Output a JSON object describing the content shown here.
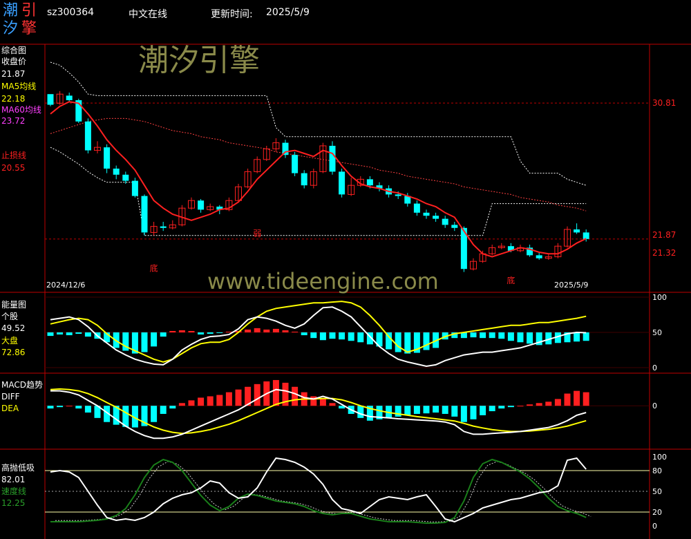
{
  "header": {
    "logo_chars": [
      "潮",
      "引",
      "汐",
      "擎"
    ],
    "code": "sz300364",
    "online": "中文在线",
    "update_label": "更新时间:",
    "update_date": "2025/5/9"
  },
  "watermarks": {
    "brand": "潮汐引擎",
    "url": "www.tideengine.com"
  },
  "colors": {
    "red": "#ff2020",
    "cyan": "#00ffff",
    "yellow": "#ffff00",
    "green": "#1a7f1a",
    "magenta": "#ff40ff",
    "divider": "#c00000"
  },
  "chart_data": [
    {
      "panel": "综合图",
      "type": "candlestick",
      "labels": {
        "close_label": "收盘价",
        "close_value": "21.87",
        "ma5_label": "MA5均线",
        "ma5_value": "22.18",
        "ma60_label": "MA60均线",
        "ma60_value": "23.72",
        "stop_label": "止损线",
        "stop_value": "20.55"
      },
      "ylim": [
        18.5,
        34.5
      ],
      "right_ticks": [
        30.81,
        21.87,
        21.32
      ],
      "annotations": [
        {
          "text": "底",
          "index": 11,
          "y": 20.2
        },
        {
          "text": "弱",
          "index": 22,
          "y": 22.5
        },
        {
          "text": "底",
          "index": 49,
          "y": 19.4
        }
      ],
      "date_start": "2024/12/6",
      "date_end": "2025/5/9",
      "candles": [
        [
          31.4,
          30.7,
          31.3,
          30.6
        ],
        [
          30.8,
          31.4,
          31.6,
          30.7
        ],
        [
          31.3,
          31.0,
          31.5,
          30.9
        ],
        [
          31.0,
          29.6,
          31.1,
          29.5
        ],
        [
          29.6,
          27.7,
          29.8,
          27.5
        ],
        [
          27.7,
          27.9,
          28.3,
          27.5
        ],
        [
          27.9,
          26.5,
          28.1,
          26.2
        ],
        [
          26.5,
          26.1,
          26.7,
          25.8
        ],
        [
          26.1,
          25.7,
          26.3,
          25.5
        ],
        [
          25.7,
          24.7,
          25.9,
          24.6
        ],
        [
          24.7,
          22.3,
          24.8,
          22.1
        ],
        [
          22.3,
          22.7,
          23.0,
          22.1
        ],
        [
          22.7,
          22.6,
          23.0,
          22.4
        ],
        [
          22.6,
          22.8,
          23.1,
          22.5
        ],
        [
          22.8,
          23.9,
          24.1,
          22.7
        ],
        [
          23.9,
          24.4,
          24.6,
          23.8
        ],
        [
          24.4,
          23.8,
          24.5,
          23.6
        ],
        [
          23.8,
          24.0,
          24.2,
          23.7
        ],
        [
          24.0,
          23.8,
          24.1,
          23.5
        ],
        [
          23.8,
          24.4,
          24.6,
          23.7
        ],
        [
          24.4,
          25.3,
          25.5,
          24.3
        ],
        [
          25.3,
          26.3,
          26.5,
          25.2
        ],
        [
          26.3,
          27.1,
          27.3,
          26.2
        ],
        [
          27.1,
          27.8,
          28.0,
          27.0
        ],
        [
          27.8,
          28.2,
          28.5,
          27.6
        ],
        [
          28.2,
          27.4,
          28.4,
          27.2
        ],
        [
          27.4,
          26.2,
          27.6,
          26.0
        ],
        [
          26.2,
          25.4,
          26.4,
          25.2
        ],
        [
          25.4,
          26.3,
          26.5,
          25.2
        ],
        [
          26.3,
          28.0,
          28.2,
          26.2
        ],
        [
          28.0,
          26.3,
          28.3,
          26.1
        ],
        [
          26.3,
          24.8,
          26.5,
          24.6
        ],
        [
          24.8,
          25.4,
          25.9,
          24.7
        ],
        [
          25.4,
          25.8,
          26.0,
          25.3
        ],
        [
          25.8,
          25.4,
          26.0,
          25.2
        ],
        [
          25.4,
          25.2,
          25.6,
          25.0
        ],
        [
          25.2,
          24.8,
          25.4,
          24.6
        ],
        [
          24.8,
          24.7,
          25.0,
          24.5
        ],
        [
          24.7,
          24.2,
          24.9,
          24.0
        ],
        [
          24.2,
          23.6,
          24.4,
          23.4
        ],
        [
          23.6,
          23.4,
          23.8,
          23.2
        ],
        [
          23.4,
          23.2,
          23.6,
          23.0
        ],
        [
          23.2,
          22.8,
          23.4,
          22.6
        ],
        [
          22.8,
          22.6,
          23.0,
          22.4
        ],
        [
          22.6,
          19.9,
          22.7,
          19.7
        ],
        [
          19.9,
          20.4,
          20.6,
          19.8
        ],
        [
          20.4,
          20.9,
          21.1,
          20.3
        ],
        [
          20.9,
          21.3,
          21.5,
          20.8
        ],
        [
          21.3,
          21.4,
          21.6,
          21.2
        ],
        [
          21.4,
          21.1,
          21.6,
          21.0
        ],
        [
          21.1,
          21.3,
          21.5,
          21.0
        ],
        [
          21.3,
          20.8,
          21.5,
          20.7
        ],
        [
          20.8,
          20.6,
          21.0,
          20.5
        ],
        [
          20.6,
          20.7,
          20.9,
          20.5
        ],
        [
          20.7,
          21.4,
          21.6,
          20.6
        ],
        [
          21.4,
          22.5,
          22.7,
          21.3
        ],
        [
          22.5,
          22.3,
          22.9,
          22.2
        ],
        [
          22.3,
          21.87,
          22.5,
          21.7
        ]
      ],
      "ma5": [
        30.1,
        30.6,
        30.9,
        30.8,
        30.1,
        29.3,
        28.4,
        27.7,
        27.1,
        26.4,
        25.4,
        24.4,
        23.9,
        23.5,
        23.3,
        23.1,
        23.3,
        23.5,
        23.8,
        23.9,
        24.3,
        25.0,
        25.8,
        26.4,
        27.0,
        27.6,
        27.7,
        27.5,
        27.3,
        27.7,
        27.5,
        26.7,
        26.0,
        25.5,
        25.3,
        25.2,
        25.0,
        24.9,
        24.7,
        24.5,
        24.2,
        24.0,
        23.6,
        23.3,
        22.4,
        21.5,
        20.9,
        20.7,
        20.9,
        21.1,
        21.3,
        21.2,
        21.0,
        20.9,
        20.9,
        21.2,
        21.6,
        21.9
      ],
      "ma60": [
        28.8,
        29.0,
        29.2,
        29.4,
        29.6,
        29.7,
        29.8,
        29.8,
        29.8,
        29.7,
        29.6,
        29.4,
        29.2,
        29.0,
        28.9,
        28.8,
        28.6,
        28.5,
        28.4,
        28.2,
        28.1,
        28.0,
        27.9,
        27.8,
        27.6,
        27.5,
        27.4,
        27.3,
        27.2,
        27.1,
        27.0,
        26.9,
        26.8,
        26.7,
        26.6,
        26.4,
        26.3,
        26.2,
        26.0,
        25.9,
        25.8,
        25.7,
        25.6,
        25.5,
        25.3,
        25.2,
        25.1,
        25.0,
        24.9,
        24.8,
        24.6,
        24.5,
        24.4,
        24.3,
        24.1,
        24.0,
        23.9,
        23.72
      ],
      "upper_band": [
        33.5,
        33.3,
        32.8,
        32.2,
        31.4,
        31.3,
        31.3,
        31.3,
        31.3,
        31.3,
        31.3,
        31.3,
        31.3,
        31.3,
        31.3,
        31.3,
        31.3,
        31.3,
        31.3,
        31.3,
        31.3,
        31.3,
        31.3,
        31.3,
        29.2,
        28.6,
        28.6,
        28.6,
        28.6,
        28.6,
        28.6,
        28.6,
        28.6,
        28.6,
        28.6,
        28.6,
        28.6,
        28.6,
        28.6,
        28.6,
        28.6,
        28.6,
        28.6,
        28.6,
        28.6,
        28.6,
        28.6,
        28.6,
        28.6,
        28.6,
        27.0,
        26.2,
        26.2,
        26.2,
        26.2,
        25.8,
        25.6,
        25.4
      ],
      "lower_band": [
        27.9,
        27.6,
        27.2,
        26.8,
        26.3,
        25.9,
        25.6,
        25.6,
        25.6,
        25.6,
        22.1,
        22.1,
        22.1,
        22.1,
        22.1,
        22.1,
        22.1,
        22.1,
        22.1,
        22.1,
        22.1,
        22.1,
        22.1,
        22.1,
        22.1,
        22.1,
        22.1,
        22.1,
        22.1,
        22.1,
        22.1,
        22.1,
        22.1,
        22.1,
        22.1,
        22.1,
        22.1,
        22.1,
        22.1,
        22.1,
        22.1,
        22.1,
        22.1,
        22.1,
        22.1,
        22.1,
        22.1,
        24.2,
        24.2,
        24.2,
        24.2,
        24.2,
        24.2,
        24.2,
        24.2,
        24.2,
        24.2,
        24.2
      ]
    },
    {
      "panel": "能量图",
      "type": "bar+line",
      "labels": {
        "stock_label": "个股",
        "stock_value": "49.52",
        "market_label": "大盘",
        "market_value": "72.86"
      },
      "ylim": [
        0,
        100
      ],
      "right_ticks": [
        100,
        50,
        0
      ],
      "bars": [
        -5,
        -3,
        -4,
        -2,
        -6,
        -9,
        -14,
        -22,
        -26,
        -30,
        -28,
        -20,
        -6,
        2,
        3,
        2,
        -3,
        -2,
        -1,
        1,
        2,
        4,
        6,
        4,
        5,
        3,
        1,
        -4,
        -8,
        -11,
        -9,
        -10,
        -12,
        -14,
        -17,
        -20,
        -24,
        -28,
        -30,
        -29,
        -25,
        -22,
        -10,
        -8,
        -8,
        -7,
        -8,
        -8,
        -9,
        -12,
        -14,
        -16,
        -18,
        -17,
        -15,
        -14,
        -13,
        -12
      ],
      "stock_line": [
        68,
        70,
        72,
        68,
        58,
        45,
        35,
        25,
        18,
        12,
        8,
        5,
        4,
        12,
        25,
        33,
        40,
        44,
        45,
        47,
        55,
        68,
        72,
        70,
        66,
        60,
        56,
        62,
        74,
        85,
        86,
        80,
        72,
        58,
        44,
        30,
        20,
        12,
        8,
        5,
        2,
        4,
        10,
        14,
        18,
        20,
        22,
        22,
        24,
        26,
        28,
        32,
        36,
        40,
        44,
        48,
        50,
        49.52
      ],
      "market_line": [
        62,
        65,
        68,
        70,
        68,
        60,
        48,
        38,
        30,
        24,
        18,
        12,
        8,
        12,
        20,
        28,
        34,
        36,
        36,
        40,
        50,
        62,
        72,
        80,
        84,
        86,
        88,
        90,
        92,
        92,
        93,
        94,
        92,
        86,
        74,
        60,
        44,
        30,
        22,
        26,
        32,
        38,
        44,
        48,
        50,
        52,
        54,
        56,
        58,
        60,
        60,
        62,
        64,
        64,
        66,
        68,
        70,
        72.86
      ]
    },
    {
      "panel": "MACD趋势",
      "type": "bar+line",
      "labels": {
        "diff_label": "DIFF",
        "dea_label": "DEA"
      },
      "ylim": [
        -1.5,
        1.0
      ],
      "right_ticks": [
        0
      ],
      "bars": [
        -0.1,
        -0.05,
        0,
        -0.1,
        -0.25,
        -0.45,
        -0.6,
        -0.7,
        -0.78,
        -0.8,
        -0.75,
        -0.6,
        -0.3,
        -0.1,
        0.1,
        0.2,
        0.3,
        0.35,
        0.4,
        0.5,
        0.6,
        0.7,
        0.8,
        0.9,
        0.95,
        0.85,
        0.7,
        0.5,
        0.35,
        0.25,
        0.1,
        -0.1,
        -0.3,
        -0.45,
        -0.55,
        -0.5,
        -0.45,
        -0.4,
        -0.35,
        -0.3,
        -0.28,
        -0.25,
        -0.3,
        -0.4,
        -0.6,
        -0.5,
        -0.35,
        -0.2,
        -0.1,
        -0.05,
        0,
        0.05,
        0.1,
        0.15,
        0.25,
        0.45,
        0.55,
        0.5
      ],
      "diff": [
        0.55,
        0.55,
        0.5,
        0.4,
        0.2,
        0,
        -0.25,
        -0.5,
        -0.75,
        -0.95,
        -1.1,
        -1.2,
        -1.2,
        -1.15,
        -1.05,
        -0.9,
        -0.75,
        -0.6,
        -0.45,
        -0.3,
        -0.15,
        0.05,
        0.25,
        0.45,
        0.6,
        0.55,
        0.45,
        0.3,
        0.25,
        0.35,
        0.25,
        0.05,
        -0.15,
        -0.3,
        -0.4,
        -0.42,
        -0.45,
        -0.48,
        -0.5,
        -0.52,
        -0.54,
        -0.56,
        -0.6,
        -0.7,
        -0.95,
        -1.05,
        -1.05,
        -1.02,
        -1.0,
        -0.98,
        -0.95,
        -0.9,
        -0.85,
        -0.8,
        -0.7,
        -0.55,
        -0.35,
        -0.25
      ],
      "dea": [
        0.6,
        0.62,
        0.6,
        0.55,
        0.45,
        0.3,
        0.12,
        -0.05,
        -0.25,
        -0.45,
        -0.62,
        -0.78,
        -0.9,
        -0.98,
        -1.02,
        -1.0,
        -0.95,
        -0.88,
        -0.78,
        -0.68,
        -0.55,
        -0.4,
        -0.25,
        -0.1,
        0.05,
        0.15,
        0.22,
        0.25,
        0.25,
        0.27,
        0.27,
        0.22,
        0.12,
        0.0,
        -0.1,
        -0.18,
        -0.25,
        -0.3,
        -0.35,
        -0.4,
        -0.44,
        -0.48,
        -0.52,
        -0.56,
        -0.65,
        -0.75,
        -0.82,
        -0.88,
        -0.92,
        -0.95,
        -0.95,
        -0.93,
        -0.9,
        -0.87,
        -0.82,
        -0.75,
        -0.65,
        -0.55
      ]
    },
    {
      "panel": "高抛低吸",
      "type": "line",
      "labels": {
        "value": "82.01",
        "speed_label": "速度线",
        "speed_value": "12.25"
      },
      "ylim": [
        0,
        100
      ],
      "right_ticks": [
        100,
        80,
        50,
        20,
        0
      ],
      "line_main": [
        78,
        80,
        78,
        70,
        50,
        30,
        12,
        8,
        10,
        8,
        12,
        20,
        32,
        40,
        45,
        48,
        55,
        65,
        62,
        48,
        40,
        42,
        55,
        78,
        98,
        96,
        92,
        85,
        75,
        60,
        38,
        25,
        22,
        18,
        28,
        38,
        42,
        40,
        38,
        42,
        45,
        28,
        10,
        6,
        12,
        18,
        26,
        30,
        34,
        38,
        40,
        44,
        48,
        50,
        58,
        95,
        98,
        82.01
      ],
      "speed_line": [
        6,
        6,
        6,
        6,
        7,
        8,
        10,
        15,
        25,
        45,
        70,
        88,
        96,
        92,
        80,
        62,
        44,
        30,
        22,
        28,
        40,
        46,
        44,
        40,
        36,
        34,
        32,
        28,
        22,
        18,
        16,
        18,
        18,
        14,
        10,
        8,
        6,
        6,
        6,
        5,
        4,
        4,
        5,
        12,
        36,
        70,
        90,
        96,
        92,
        85,
        78,
        68,
        55,
        40,
        28,
        22,
        18,
        12.25
      ]
    }
  ]
}
